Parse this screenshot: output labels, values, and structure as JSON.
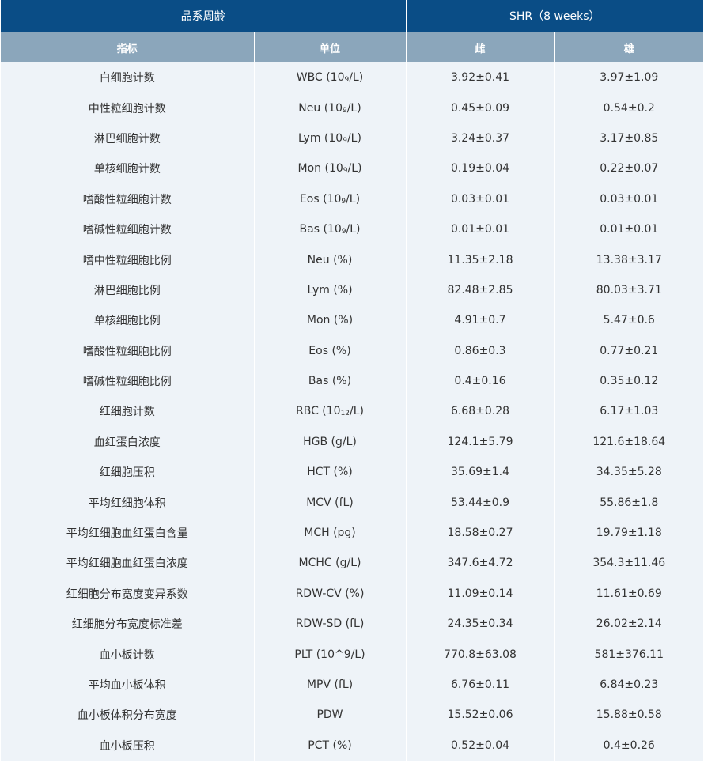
{
  "header": {
    "group_label": "品系周龄",
    "strain_label": "SHR（8 weeks）"
  },
  "columns": {
    "indicator": "指标",
    "unit": "单位",
    "female": "雌",
    "male": "雄"
  },
  "rows": [
    {
      "name": "白细胞计数",
      "unit": "WBC (109/L)",
      "female": "3.92±0.41",
      "male": "3.97±1.09"
    },
    {
      "name": "中性粒细胞计数",
      "unit": "Neu (109/L)",
      "female": "0.45±0.09",
      "male": "0.54±0.2"
    },
    {
      "name": "淋巴细胞计数",
      "unit": "Lym (109/L)",
      "female": "3.24±0.37",
      "male": "3.17±0.85"
    },
    {
      "name": "单核细胞计数",
      "unit": "Mon (109/L)",
      "female": "0.19±0.04",
      "male": "0.22±0.07"
    },
    {
      "name": "嗜酸性粒细胞计数",
      "unit": "Eos (109/L)",
      "female": "0.03±0.01",
      "male": "0.03±0.01"
    },
    {
      "name": "嗜碱性粒细胞计数",
      "unit": "Bas (109/L)",
      "female": "0.01±0.01",
      "male": "0.01±0.01"
    },
    {
      "name": "嗜中性粒细胞比例",
      "unit": "Neu (%)",
      "female": "11.35±2.18",
      "male": "13.38±3.17"
    },
    {
      "name": "淋巴细胞比例",
      "unit": "Lym (%)",
      "female": "82.48±2.85",
      "male": "80.03±3.71"
    },
    {
      "name": "单核细胞比例",
      "unit": "Mon (%)",
      "female": "4.91±0.7",
      "male": "5.47±0.6"
    },
    {
      "name": "嗜酸性粒细胞比例",
      "unit": "Eos (%)",
      "female": "0.86±0.3",
      "male": "0.77±0.21"
    },
    {
      "name": "嗜碱性粒细胞比例",
      "unit": "Bas (%)",
      "female": "0.4±0.16",
      "male": "0.35±0.12"
    },
    {
      "name": "红细胞计数",
      "unit": "RBC (1012/L)",
      "female": "6.68±0.28",
      "male": "6.17±1.03"
    },
    {
      "name": "血红蛋白浓度",
      "unit": "HGB (g/L)",
      "female": "124.1±5.79",
      "male": "121.6±18.64"
    },
    {
      "name": "红细胞压积",
      "unit": "HCT (%)",
      "female": "35.69±1.4",
      "male": "34.35±5.28"
    },
    {
      "name": "平均红细胞体积",
      "unit": "MCV (fL)",
      "female": "53.44±0.9",
      "male": "55.86±1.8"
    },
    {
      "name": "平均红细胞血红蛋白含量",
      "unit": "MCH (pg)",
      "female": "18.58±0.27",
      "male": "19.79±1.18"
    },
    {
      "name": "平均红细胞血红蛋白浓度",
      "unit": "MCHC (g/L)",
      "female": "347.6±4.72",
      "male": "354.3±11.46"
    },
    {
      "name": "红细胞分布宽度变异系数",
      "unit": "RDW-CV (%)",
      "female": "11.09±0.14",
      "male": "11.61±0.69"
    },
    {
      "name": "红细胞分布宽度标准差",
      "unit": "RDW-SD (fL)",
      "female": "24.35±0.34",
      "male": "26.02±2.14"
    },
    {
      "name": "血小板计数",
      "unit": "PLT (10^9/L)",
      "female": "770.8±63.08",
      "male": "581±376.11"
    },
    {
      "name": "平均血小板体积",
      "unit": "MPV (fL)",
      "female": "6.76±0.11",
      "male": "6.84±0.23"
    },
    {
      "name": "血小板体积分布宽度",
      "unit": "PDW",
      "female": "15.52±0.06",
      "male": "15.88±0.58"
    },
    {
      "name": "血小板压积",
      "unit": "PCT (%)",
      "female": "0.52±0.04",
      "male": "0.4±0.26"
    }
  ]
}
